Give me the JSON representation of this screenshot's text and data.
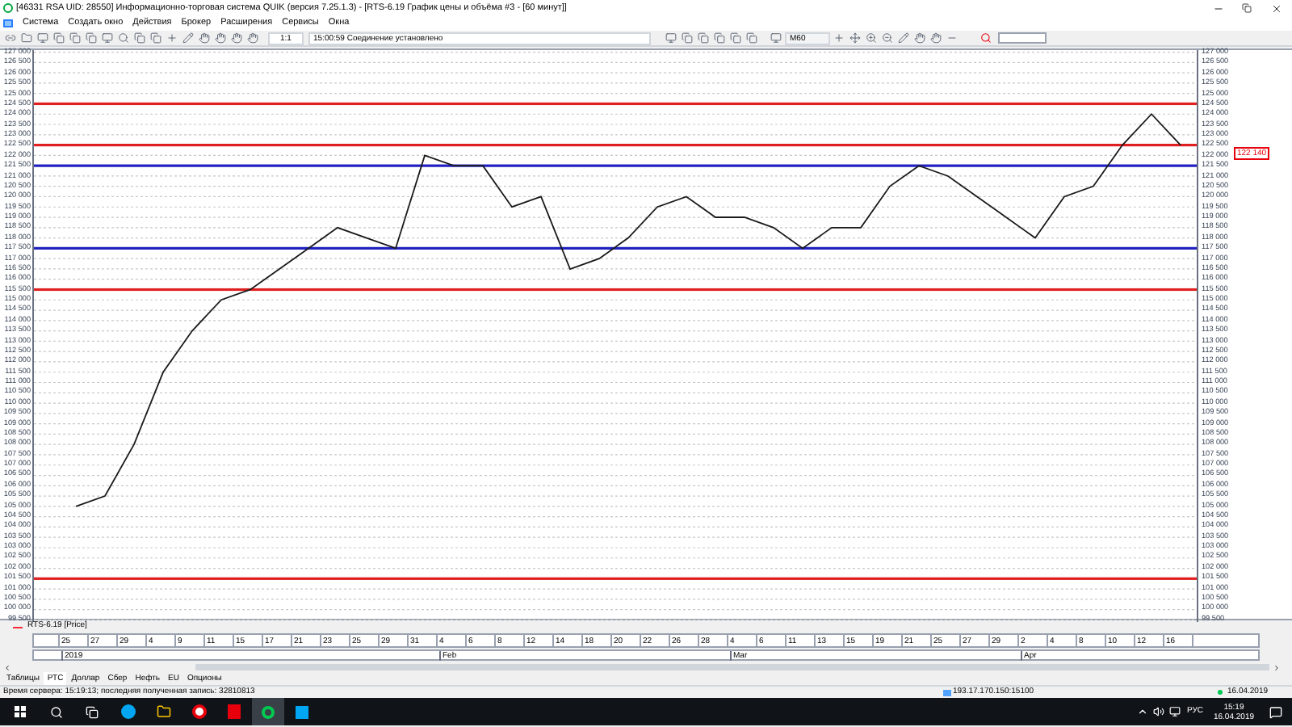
{
  "window": {
    "title": "[46331 RSA UID: 28550] Информационно-торговая система QUIK (версия 7.25.1.3) - [RTS-6.19 График цены и объёма #3 - [60 минут]]"
  },
  "menu": [
    "Система",
    "Создать окно",
    "Действия",
    "Брокер",
    "Расширения",
    "Сервисы",
    "Окна"
  ],
  "toolbar": {
    "scale": "1:1",
    "connection_status": "15:00:59 Соединение установлено",
    "interval": "M60"
  },
  "chart": {
    "last_price": "122 140",
    "chart_data": {
      "type": "line",
      "categories": [
        "25",
        "27",
        "29",
        "4",
        "9",
        "11",
        "15",
        "17",
        "21",
        "23",
        "25",
        "29",
        "31",
        "4",
        "6",
        "8",
        "12",
        "14",
        "18",
        "20",
        "22",
        "26",
        "28",
        "4",
        "6",
        "11",
        "13",
        "15",
        "19",
        "21",
        "25",
        "27",
        "29",
        "2",
        "4",
        "8",
        "10",
        "12",
        "16"
      ],
      "series": [
        {
          "name": "RTS-6.19 [Price]",
          "color": "#1a1a1a",
          "values": [
            105000,
            105500,
            108000,
            111500,
            113500,
            115000,
            115500,
            116500,
            117500,
            118500,
            118000,
            117500,
            122000,
            121500,
            121500,
            119500,
            120000,
            116500,
            117000,
            118000,
            119500,
            120000,
            119000,
            119000,
            118500,
            117500,
            118500,
            118500,
            120500,
            121500,
            121000,
            120000,
            119000,
            118000,
            120000,
            120500,
            122500,
            124000,
            122500
          ]
        }
      ],
      "ylim": [
        99400,
        127100
      ],
      "yticks": [
        {
          "value": 127000,
          "label": "127 000"
        },
        {
          "value": 126500,
          "label": "126 500"
        },
        {
          "value": 126000,
          "label": "126 000"
        },
        {
          "value": 125500,
          "label": "125 500"
        },
        {
          "value": 125000,
          "label": "125 000"
        },
        {
          "value": 124500,
          "label": "124 500"
        },
        {
          "value": 124000,
          "label": "124 000"
        },
        {
          "value": 123500,
          "label": "123 500"
        },
        {
          "value": 123000,
          "label": "123 000"
        },
        {
          "value": 122500,
          "label": "122 500"
        },
        {
          "value": 122000,
          "label": "122 000"
        },
        {
          "value": 121500,
          "label": "121 500"
        },
        {
          "value": 121000,
          "label": "121 000"
        },
        {
          "value": 120500,
          "label": "120 500"
        },
        {
          "value": 120000,
          "label": "120 000"
        },
        {
          "value": 119500,
          "label": "119 500"
        },
        {
          "value": 119000,
          "label": "119 000"
        },
        {
          "value": 118500,
          "label": "118 500"
        },
        {
          "value": 118000,
          "label": "118 000"
        },
        {
          "value": 117500,
          "label": "117 500"
        },
        {
          "value": 117000,
          "label": "117 000"
        },
        {
          "value": 116500,
          "label": "116 500"
        },
        {
          "value": 116000,
          "label": "116 000"
        },
        {
          "value": 115500,
          "label": "115 500"
        },
        {
          "value": 115000,
          "label": "115 000"
        },
        {
          "value": 114500,
          "label": "114 500"
        },
        {
          "value": 114000,
          "label": "114 000"
        },
        {
          "value": 113500,
          "label": "113 500"
        },
        {
          "value": 113000,
          "label": "113 000"
        },
        {
          "value": 112500,
          "label": "112 500"
        },
        {
          "value": 112000,
          "label": "112 000"
        },
        {
          "value": 111500,
          "label": "111 500"
        },
        {
          "value": 111000,
          "label": "111 000"
        },
        {
          "value": 110500,
          "label": "110 500"
        },
        {
          "value": 110000,
          "label": "110 000"
        },
        {
          "value": 109500,
          "label": "109 500"
        },
        {
          "value": 109000,
          "label": "109 000"
        },
        {
          "value": 108500,
          "label": "108 500"
        },
        {
          "value": 108000,
          "label": "108 000"
        },
        {
          "value": 107500,
          "label": "107 500"
        },
        {
          "value": 107000,
          "label": "107 000"
        },
        {
          "value": 106500,
          "label": "106 500"
        },
        {
          "value": 106000,
          "label": "106 000"
        },
        {
          "value": 105500,
          "label": "105 500"
        },
        {
          "value": 105000,
          "label": "105 000"
        },
        {
          "value": 104500,
          "label": "104 500"
        },
        {
          "value": 104000,
          "label": "104 000"
        },
        {
          "value": 103500,
          "label": "103 500"
        },
        {
          "value": 103000,
          "label": "103 000"
        },
        {
          "value": 102500,
          "label": "102 500"
        },
        {
          "value": 102000,
          "label": "102 000"
        },
        {
          "value": 101500,
          "label": "101 500"
        },
        {
          "value": 101000,
          "label": "101 000"
        },
        {
          "value": 100500,
          "label": "100 500"
        },
        {
          "value": 100000,
          "label": "100 000"
        },
        {
          "value": 99500,
          "label": "99 500"
        }
      ],
      "grid": true,
      "ref_lines": [
        {
          "axis": "y",
          "value": 124500,
          "color": "#e02020"
        },
        {
          "axis": "y",
          "value": 122500,
          "color": "#e02020"
        },
        {
          "axis": "y",
          "value": 121500,
          "color": "#2020c0"
        },
        {
          "axis": "y",
          "value": 117500,
          "color": "#2020c0"
        },
        {
          "axis": "y",
          "value": 115500,
          "color": "#e02020"
        },
        {
          "axis": "y",
          "value": 101500,
          "color": "#e02020"
        }
      ]
    },
    "right_axis_labels": [
      "127 000",
      "126 500",
      "126 000",
      "125 500",
      "125 000",
      "124 500",
      "124 000",
      "123 500",
      "123 000",
      "122 500",
      "122 000",
      "121 500",
      "121 000",
      "120 500",
      "120 000",
      "119 500",
      "119 000",
      "118 500",
      "118 000",
      "117 500",
      "117 000",
      "116 500",
      "116 000",
      "115 500",
      "115 000",
      "114 500",
      "114 000",
      "113 500",
      "113 000",
      "112 500",
      "112 000",
      "111 500",
      "111 000",
      "110 500",
      "110 000",
      "109 500",
      "109 000",
      "108 500",
      "108 000",
      "107 500",
      "107 000",
      "106 500",
      "106 000",
      "105 500",
      "105 000",
      "104 500",
      "104 000",
      "103 500",
      "103 000",
      "102 500",
      "102 000",
      "101 500",
      "101 000",
      "100 500",
      "100 000",
      "99 500"
    ],
    "months": [
      "2019",
      "Feb",
      "Mar",
      "Apr"
    ]
  },
  "tabs": [
    {
      "label": "Таблицы",
      "selected": false
    },
    {
      "label": "РТС",
      "selected": true
    },
    {
      "label": "Доллар",
      "selected": false
    },
    {
      "label": "Сбер",
      "selected": false
    },
    {
      "label": "Нефть",
      "selected": false
    },
    {
      "label": "EU",
      "selected": false
    },
    {
      "label": "Опционы",
      "selected": false
    }
  ],
  "status_bar": {
    "message": "Время сервера: 15:19:13; последняя полученная запись: 32810813",
    "server": "193.17.170.150:15100",
    "date": "16.04.2019"
  },
  "taskbar": {
    "language": "РУС",
    "time": "15:19",
    "date": "16.04.2019"
  }
}
